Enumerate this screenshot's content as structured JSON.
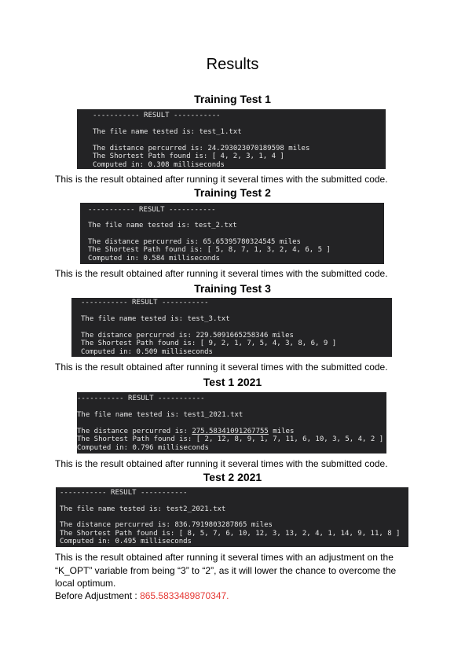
{
  "page_title": "Results",
  "sections": [
    {
      "heading": "Training Test 1",
      "terminal": {
        "header": "----------- RESULT -----------",
        "file_line": "The file name tested is: test_1.txt",
        "distance_label": "The distance percurred is: ",
        "distance_value": "24.293023070189598",
        "distance_unit": " miles",
        "path_line": "The Shortest Path found is: [ 4, 2, 3, 1, 4 ]",
        "time_line": "Computed in: 0.308 milliseconds"
      },
      "caption": "This is the result obtained after running it several times with the submitted code."
    },
    {
      "heading": "Training Test 2",
      "terminal": {
        "header": "----------- RESULT -----------",
        "file_line": "The file name tested is: test_2.txt",
        "distance_label": "The distance percurred is: ",
        "distance_value": "65.65395780324545",
        "distance_unit": " miles",
        "path_line": "The Shortest Path found is: [ 5, 8, 7, 1, 3, 2, 4, 6, 5 ]",
        "time_line": "Computed in: 0.584 milliseconds"
      },
      "caption": "This is the result obtained after running it several times with the submitted code."
    },
    {
      "heading": "Training Test 3",
      "terminal": {
        "header": "----------- RESULT -----------",
        "file_line": "The file name tested is: test_3.txt",
        "distance_label": "The distance percurred is: ",
        "distance_value": "229.5091665258346",
        "distance_unit": " miles",
        "path_line": "The Shortest Path found is: [ 9, 2, 1, 7, 5, 4, 3, 8, 6, 9 ]",
        "time_line": "Computed in: 0.509 milliseconds"
      },
      "caption": "This is the result obtained after running it several times with the submitted code."
    },
    {
      "heading": "Test 1 2021",
      "terminal": {
        "header": "----------- RESULT -----------",
        "file_line": "The file name tested is: test1_2021.txt",
        "distance_label": "The distance percurred is: ",
        "distance_value": "275.58341091267755",
        "distance_unit": " miles",
        "path_line": "The Shortest Path found is: [ 2, 12, 8, 9, 1, 7, 11, 6, 10, 3, 5, 4, 2 ]",
        "time_line": "Computed in: 0.796 milliseconds"
      },
      "caption": "This is the result obtained after running it several times with the submitted code."
    },
    {
      "heading": "Test 2 2021",
      "terminal": {
        "header": "----------- RESULT -----------",
        "file_line": "The file name tested is: test2_2021.txt",
        "distance_label": "The distance percurred is: ",
        "distance_value": "836.7919803287865",
        "distance_unit": " miles",
        "path_line": "The Shortest Path found is: [ 8, 5, 7, 6, 10, 12, 3, 13, 2, 4, 1, 14, 9, 11, 8 ]",
        "time_line": "Computed in: 0.495 milliseconds"
      },
      "caption_lines": [
        "This is the result obtained after running it several times with an adjustment on the",
        "“K_OPT” variable from being “3” to “2”, as it will lower the chance to overcome the",
        "local optimum."
      ]
    }
  ],
  "before_adjustment": {
    "label": "Before Adjustment : ",
    "value": "865.5833489870347."
  },
  "colors": {
    "terminal_bg": "#232325",
    "terminal_text": "#e6e6e6",
    "highlight_red": "#e53935"
  }
}
